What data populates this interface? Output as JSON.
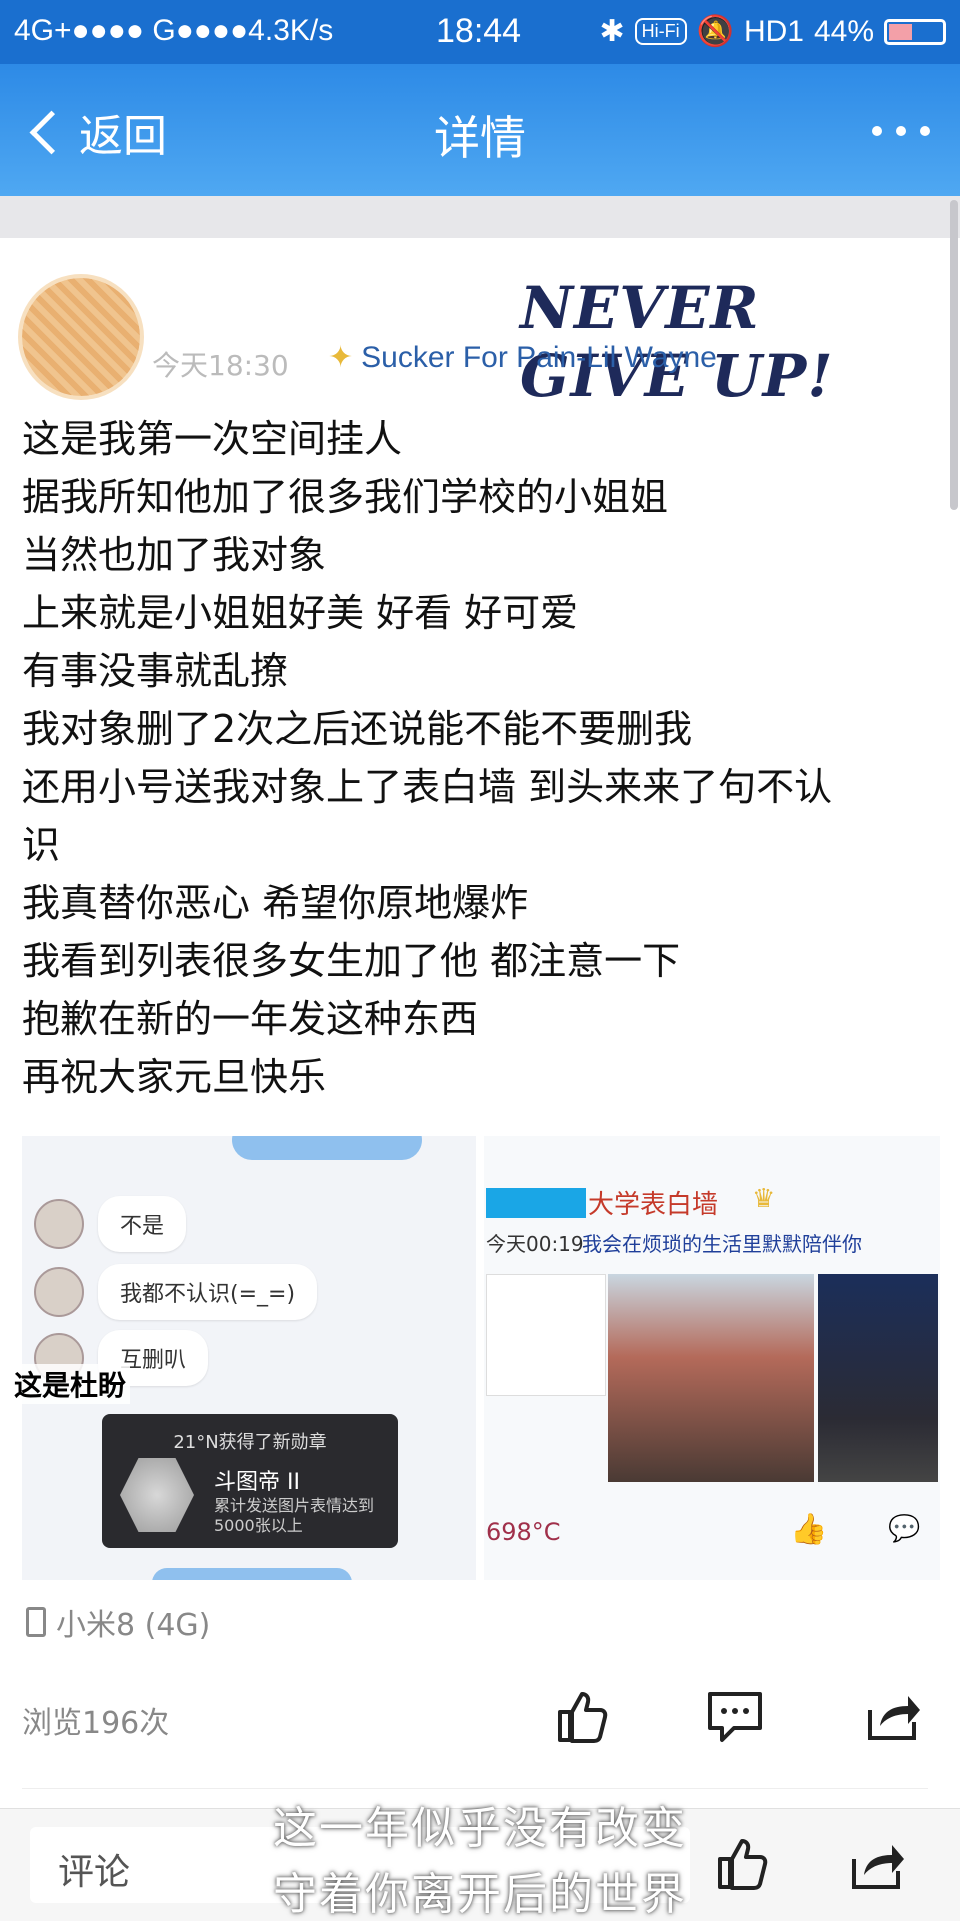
{
  "status_bar": {
    "left": "4G+●●●● G●●●●4.3K/s",
    "time": "18:44",
    "hifi": "Hi-Fi",
    "network": "HD1",
    "battery": "44%",
    "battery_level": 0.44
  },
  "nav": {
    "back_label": "返回",
    "title": "详情"
  },
  "post": {
    "banner": "NEVER GIVE UP!",
    "time": "今天18:30",
    "signature": "Sucker For Pain-Lil Wayne",
    "lines": [
      "这是我第一次空间挂人",
      "据我所知他加了很多我们学校的小姐姐",
      "当然也加了我对象",
      "上来就是小姐姐好美 好看 好可爱",
      "有事没事就乱撩",
      "我对象删了2次之后还说能不能不要删我",
      "还用小号送我对象上了表白墙 到头来来了句不认",
      "识",
      "我真替你恶心 希望你原地爆炸",
      "我看到列表很多女生加了他 都注意一下",
      "抱歉在新的一年发这种东西",
      "再祝大家元旦快乐"
    ]
  },
  "left_image": {
    "chat": [
      "不是",
      "我都不认识(=_=)",
      "互删叭"
    ],
    "overlay_label": "这是杜盼",
    "medal_title": "21°N获得了新勋章",
    "medal_name": "斗图帝 II",
    "medal_desc": "累计发送图片表情达到5000张以上"
  },
  "right_image": {
    "wall_name": "大学表白墙",
    "wall_time": "今天00:19",
    "wall_msg": "我会在烦琐的生活里默默陪伴你",
    "temperature": "698°C"
  },
  "device": "小米8 (4G)",
  "views": "浏览196次",
  "bottom": {
    "comment_placeholder": "评论"
  },
  "subtitles": [
    "这一年似乎没有改变",
    "守着你离开后的世界"
  ],
  "colors": {
    "status_bar": "#1a6fcf",
    "nav_bar": "#3d9ae9",
    "text": "#111111",
    "meta": "#888888"
  }
}
